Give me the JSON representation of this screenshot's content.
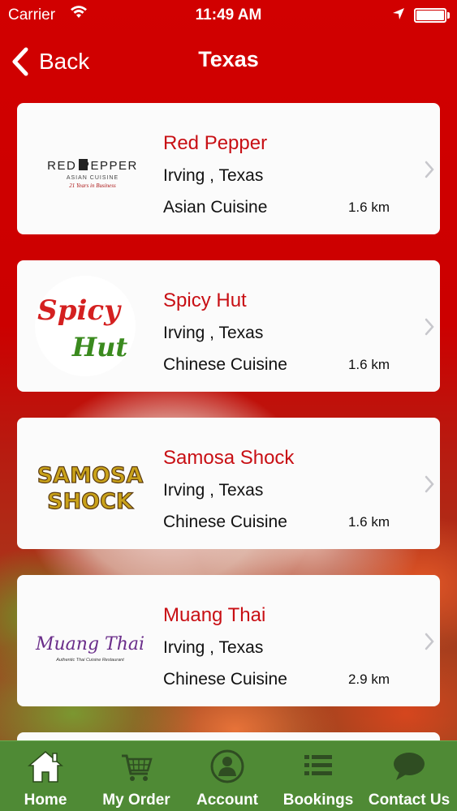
{
  "status_bar": {
    "carrier": "Carrier",
    "time": "11:49 AM"
  },
  "nav": {
    "back_label": "Back",
    "title": "Texas"
  },
  "restaurants": [
    {
      "name": "Red Pepper",
      "city": "Irving , Texas",
      "cuisine": "Asian Cuisine",
      "distance": "1.6 km",
      "logo": {
        "line1": "RED PEPPER",
        "line2": "ASIAN CUISINE",
        "line3": "21 Years in Business"
      }
    },
    {
      "name": "Spicy Hut",
      "city": "Irving , Texas",
      "cuisine": "Chinese Cuisine",
      "distance": "1.6 km",
      "logo": {
        "line1": "Spicy",
        "line2": "Hut"
      }
    },
    {
      "name": "Samosa Shock",
      "city": "Irving , Texas",
      "cuisine": "Chinese Cuisine",
      "distance": "1.6 km",
      "logo": {
        "line1": "SAMOSA",
        "line2": "SHOCK"
      }
    },
    {
      "name": "Muang Thai",
      "city": "Irving , Texas",
      "cuisine": "Chinese Cuisine",
      "distance": "2.9 km",
      "logo": {
        "line1": "Muang Thai",
        "line2": "Authentic Thai Cuisine Restaurant"
      }
    }
  ],
  "tab_bar": {
    "items": [
      {
        "label": "Home",
        "icon": "home-icon"
      },
      {
        "label": "My Order",
        "icon": "cart-icon"
      },
      {
        "label": "Account",
        "icon": "account-icon"
      },
      {
        "label": "Bookings",
        "icon": "list-icon"
      },
      {
        "label": "Contact Us",
        "icon": "chat-icon"
      }
    ]
  },
  "colors": {
    "header_red": "#cc0000",
    "name_red": "#c80f14",
    "tab_green": "#4f8a35"
  }
}
